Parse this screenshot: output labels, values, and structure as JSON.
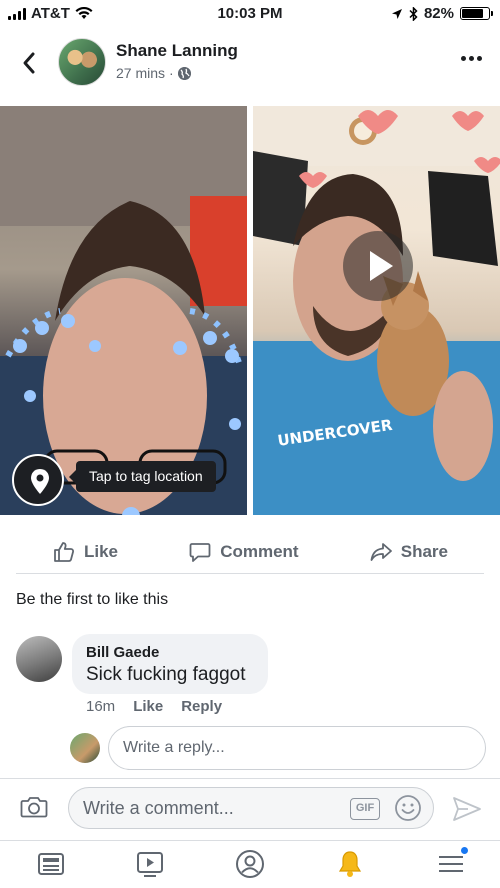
{
  "status_bar": {
    "carrier": "AT&T",
    "time": "10:03 PM",
    "battery": "82%",
    "battery_level": 0.82
  },
  "post": {
    "author": "Shane Lanning",
    "time_ago": "27 mins",
    "separator": "·",
    "tag_location_label": "Tap to tag location"
  },
  "actions": {
    "like": "Like",
    "comment": "Comment",
    "share": "Share"
  },
  "likes_summary": "Be the first to like this",
  "comment": {
    "author": "Bill Gaede",
    "text": "Sick fucking faggot",
    "time_ago": "16m",
    "like_label": "Like",
    "reply_label": "Reply"
  },
  "reply_box": {
    "placeholder": "Write a reply..."
  },
  "composer": {
    "placeholder": "Write a comment...",
    "gif_label": "GIF"
  },
  "colors": {
    "accent": "#1877f2",
    "text_secondary": "#606770",
    "bubble": "#f0f2f5"
  },
  "icons": [
    "wifi-icon",
    "location-arrow-icon",
    "bluetooth-icon",
    "back-icon",
    "globe-icon",
    "more-icon",
    "play-icon",
    "map-pin-icon",
    "like-icon",
    "comment-icon",
    "share-icon",
    "camera-icon",
    "emoji-icon",
    "send-icon",
    "news-feed-icon",
    "watch-icon",
    "profile-icon",
    "bell-icon",
    "menu-icon"
  ]
}
